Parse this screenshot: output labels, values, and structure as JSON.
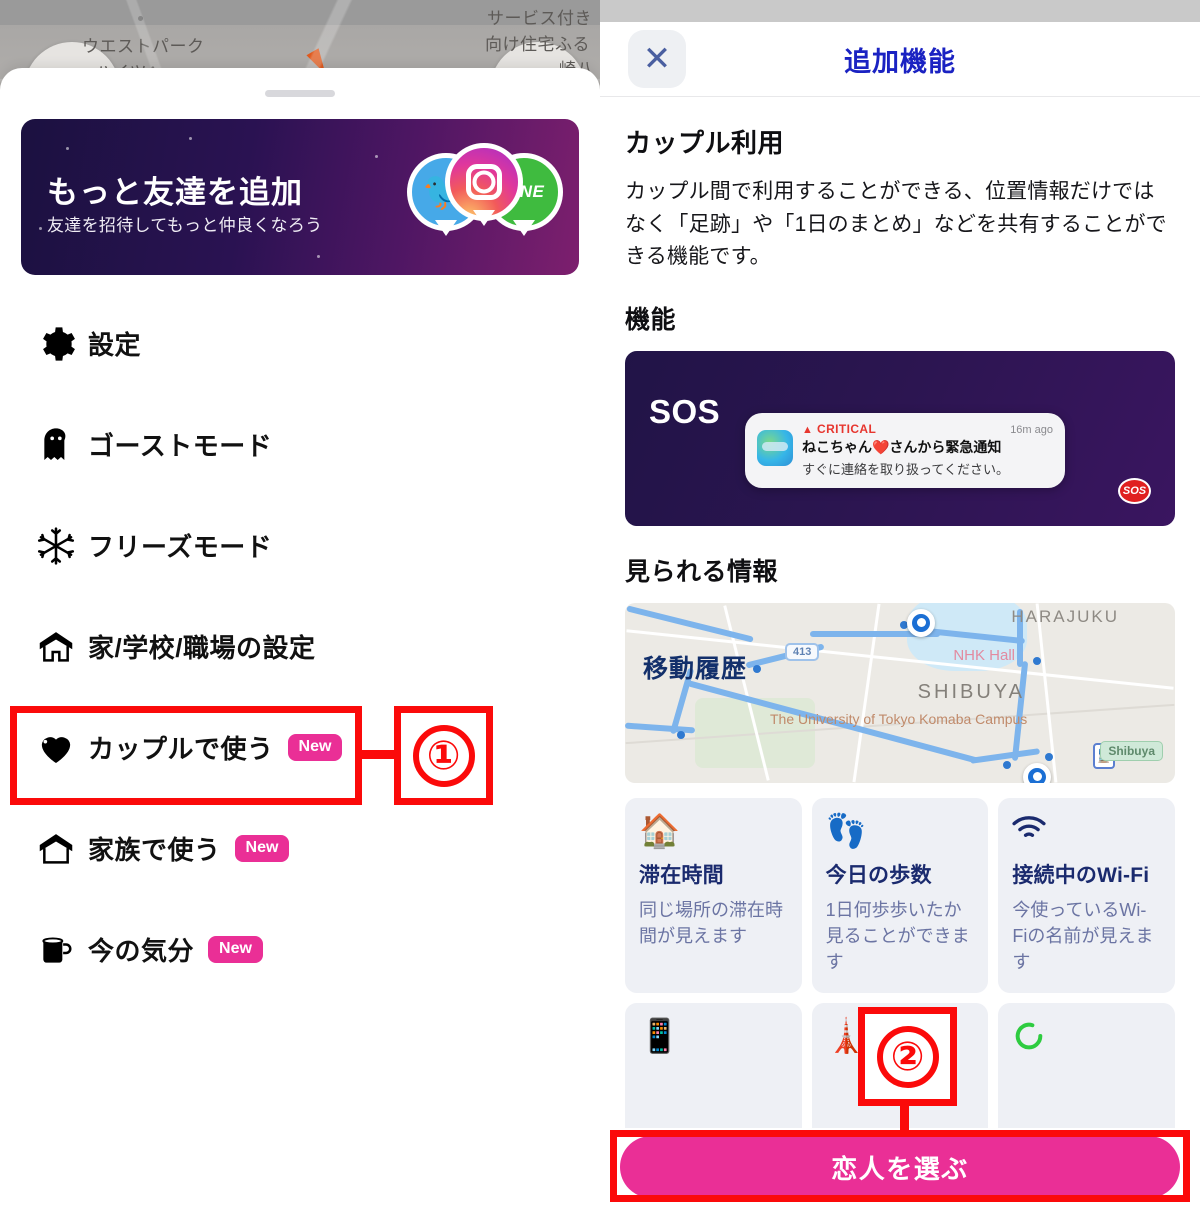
{
  "left_panel": {
    "map_background": {
      "labels": [
        "ウエストパーク",
        "ハイツA",
        "サービス付き",
        "向け住宅ふる",
        "崎八"
      ]
    },
    "promo_banner": {
      "title": "もっと友達を追加",
      "subtitle": "友達を招待してもっと仲良くなろう",
      "social_icons": [
        "twitter-icon",
        "instagram-icon",
        "line-icon"
      ],
      "line_label": "LINE"
    },
    "menu_items": [
      {
        "icon": "gear-icon",
        "label": "設定",
        "badge": ""
      },
      {
        "icon": "ghost-icon",
        "label": "ゴーストモード",
        "badge": ""
      },
      {
        "icon": "snowflake-icon",
        "label": "フリーズモード",
        "badge": ""
      },
      {
        "icon": "house-icon",
        "label": "家/学校/職場の設定",
        "badge": ""
      },
      {
        "icon": "heart-icon",
        "label": "カップルで使う",
        "badge": "New"
      },
      {
        "icon": "house-outline-icon",
        "label": "家族で使う",
        "badge": "New"
      },
      {
        "icon": "mug-icon",
        "label": "今の気分",
        "badge": "New"
      }
    ],
    "annotation": {
      "number": "①"
    }
  },
  "right_panel": {
    "topbar": {
      "close_icon": "close-icon",
      "title": "追加機能"
    },
    "section_couple": {
      "heading": "カップル利用",
      "description": "カップル間で利用することができる、位置情報だけではなく「足跡」や「1日のまとめ」などを共有することができる機能です。"
    },
    "section_features": {
      "heading": "機能",
      "sos_card": {
        "label": "SOS",
        "notification": {
          "critical_label": "CRITICAL",
          "time": "16m ago",
          "title": "ねこちゃん❤️さんから緊急通知",
          "body": "すぐに連絡を取り扱ってください。"
        },
        "badge": "SOS"
      }
    },
    "section_visible_info": {
      "heading": "見られる情報",
      "map_card": {
        "overlay_label": "移動履歴",
        "place_labels": [
          "HARAJUKU",
          "NHK Hall",
          "SHIBUYA",
          "The University of Tokyo Komaba Campus",
          "Shibuya"
        ],
        "route_shield": "413"
      },
      "cards": [
        {
          "icon": "houses-emoji",
          "title": "滞在時間",
          "desc": "同じ場所の滞在時間が見えます"
        },
        {
          "icon": "footprints-emoji",
          "title": "今日の歩数",
          "desc": "1日何歩歩いたか見ることができます"
        },
        {
          "icon": "wifi-icon",
          "title": "接続中のWi-Fi",
          "desc": "今使っているWi-Fiの名前が見えます"
        },
        {
          "icon": "phone-emoji",
          "title": "",
          "desc": ""
        },
        {
          "icon": "tokyo-tower-emoji",
          "title": "",
          "desc": ""
        },
        {
          "icon": "spinner-icon",
          "title": "",
          "desc": ""
        }
      ]
    },
    "cta": {
      "label": "恋人を選ぶ"
    },
    "annotation": {
      "number": "②"
    }
  },
  "colors": {
    "accent_pink": "#ea2f96",
    "annotation_red": "#fb0a0a",
    "title_blue": "#1a22c2",
    "card_title_blue": "#1a2a6e",
    "promo_dark": "#211447"
  }
}
